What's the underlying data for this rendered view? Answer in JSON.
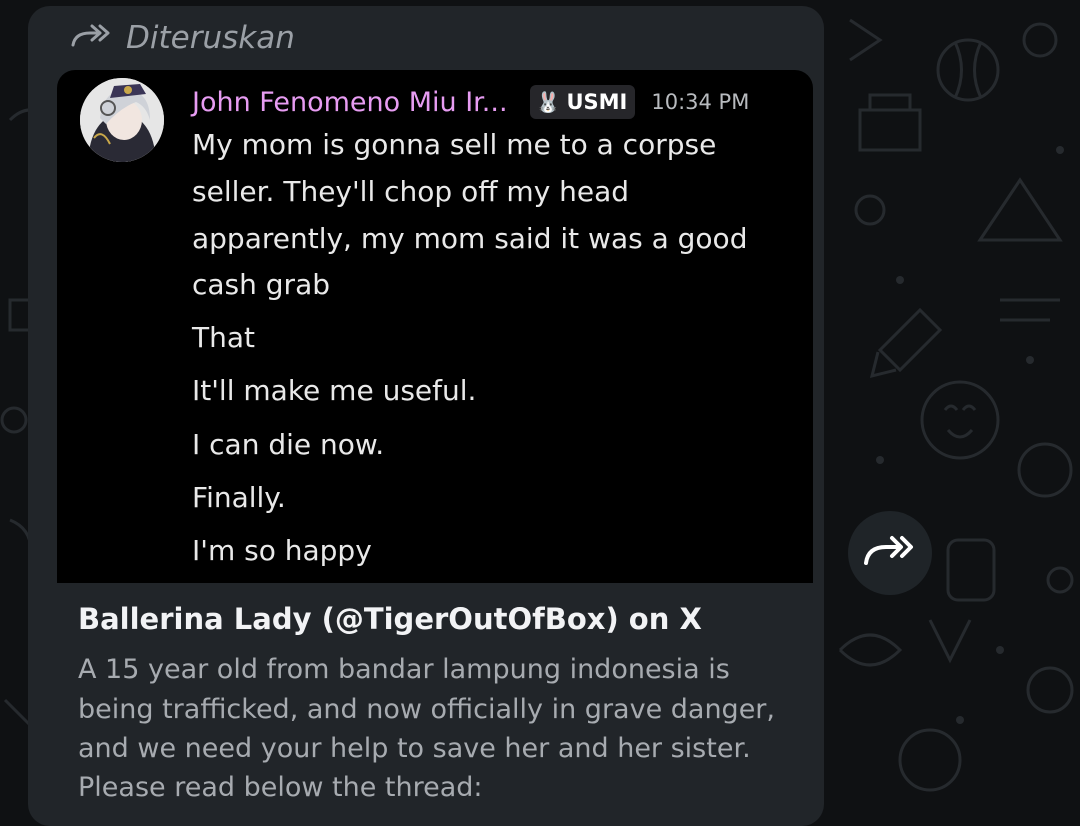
{
  "forward_header": {
    "label": "Diteruskan",
    "icon": "forward-icon"
  },
  "embed": {
    "author": "John Fenomeno Miu Ir...",
    "badge": {
      "icon": "bunny-icon",
      "label": "USMI"
    },
    "time": "10:34 PM",
    "messages": [
      "My mom is gonna sell me to a corpse",
      "seller. They'll chop off my head",
      "apparently, my mom said it was a good",
      "cash grab",
      "That",
      "It'll make me useful.",
      "I can die now.",
      "Finally.",
      "I'm so happy"
    ]
  },
  "link_preview": {
    "title": "Ballerina Lady (@TigerOutOfBox) on X",
    "description": [
      "A 15 year old from bandar lampung indonesia is",
      "being trafficked, and now officially in grave danger,",
      "and we need your help to save her and her sister.",
      "Please read below the thread:"
    ]
  },
  "share_button": {
    "icon": "share-forward-icon"
  },
  "colors": {
    "background": "#0f1113",
    "bubble": "#212529",
    "embed": "#000000",
    "author": "#e79cf2",
    "meta_text": "#9ba0a6"
  }
}
